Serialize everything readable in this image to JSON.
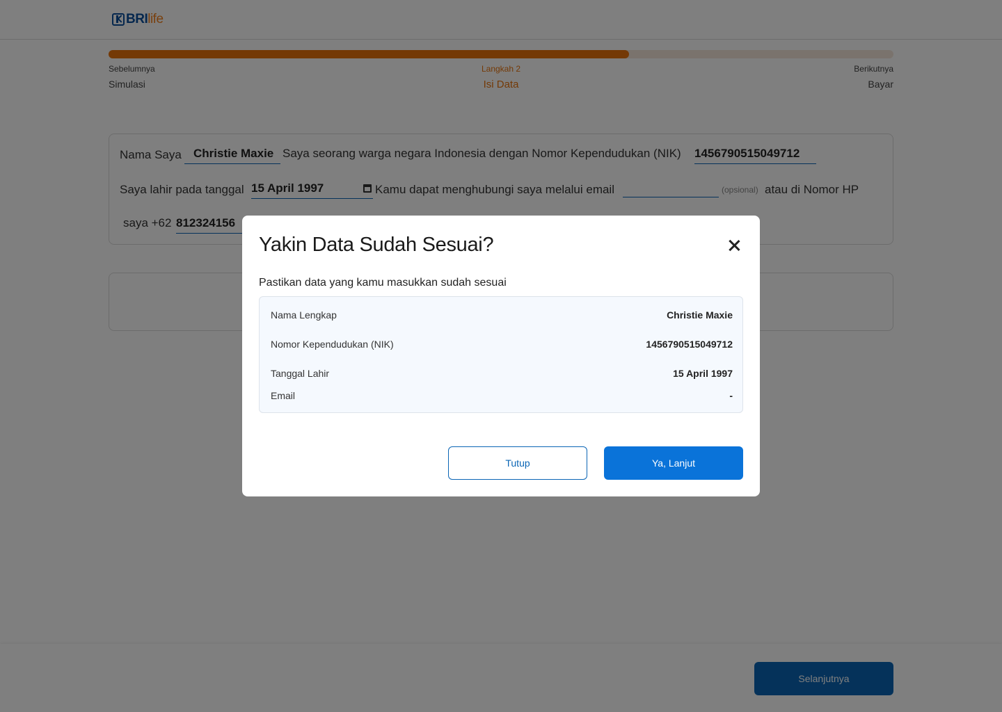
{
  "header": {
    "logo_bri": "BRI",
    "logo_life": "life"
  },
  "progress": {
    "fraction": 0.663,
    "prev_small": "Sebelumnya",
    "prev_big": "Simulasi",
    "current_small": "Langkah 2",
    "current_big": "Isi Data",
    "next_small": "Berikutnya",
    "next_big": "Bayar"
  },
  "form": {
    "nama_prefix": "Nama Saya",
    "nama_value": "Christie Maxie",
    "warga_text": "Saya seorang warga negara Indonesia dengan Nomor Kependudukan (NIK)",
    "nik_value": "1456790515049712",
    "lahir_prefix": "Saya lahir pada tanggal",
    "lahir_value": "15 April 1997",
    "email_text": "Kamu dapat menghubungi saya melalui email",
    "email_value": "",
    "email_optional": "(opsional)",
    "hp_text": "atau di Nomor HP",
    "saya_prefix": "saya +62",
    "hp_value": "812324156"
  },
  "footer": {
    "next_label": "Selanjutnya"
  },
  "modal": {
    "title": "Yakin Data Sudah Sesuai?",
    "subtitle": "Pastikan data yang kamu masukkan sudah sesuai",
    "rows": [
      {
        "label": "Nama Lengkap",
        "value": "Christie Maxie"
      },
      {
        "label": "Nomor Kependudukan (NIK)",
        "value": "1456790515049712"
      },
      {
        "label": "Tanggal Lahir",
        "value": "15 April 1997"
      },
      {
        "label": "Email",
        "value": "-"
      }
    ],
    "btn_close": "Tutup",
    "btn_confirm": "Ya, Lanjut"
  },
  "colors": {
    "brand_blue": "#0b4f9c",
    "brand_orange": "#e8730c",
    "button_blue": "#0a73d9"
  }
}
